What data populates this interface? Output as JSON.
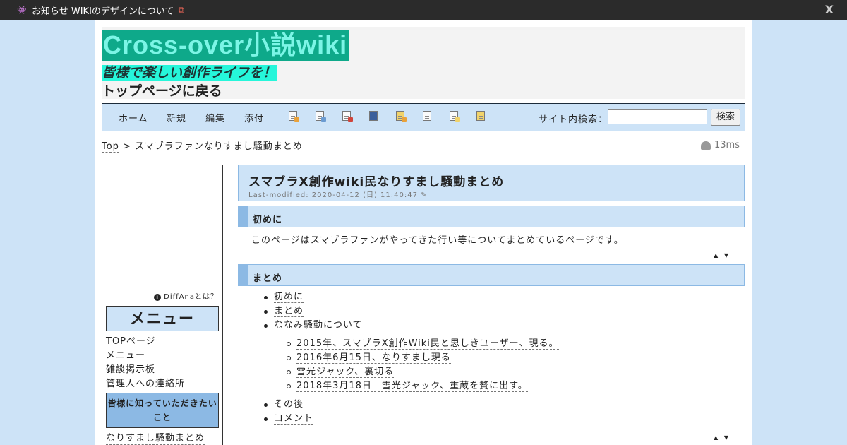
{
  "topbar": {
    "notice": "お知らせ WIKIのデザインについて",
    "close": "X"
  },
  "site": {
    "logo": "Cross-over小説wiki",
    "tagline": "皆様で楽しい創作ライフを！",
    "back_link": "トップページに戻る"
  },
  "nav": {
    "home": "ホーム",
    "new": "新規",
    "edit": "編集",
    "attach": "添付",
    "toolbar_icons": [
      "copy-page-icon",
      "rename-page-icon",
      "diff-page-icon",
      "backup-icon",
      "history-icon",
      "list-icon",
      "recent-icon",
      "help-icon"
    ]
  },
  "search": {
    "label": "サイト内検索：",
    "button": "検索",
    "value": ""
  },
  "breadcrumb": {
    "top": "Top",
    "sep": ">",
    "current": "スマブラファンなりすまし騒動まとめ"
  },
  "timer": "13ms",
  "sidebar": {
    "diffana": "DiffAnaとは？",
    "menu_title": "メニュー",
    "links": [
      "TOPページ",
      "メニュー",
      "雑談掲示板",
      "管理人への連絡所"
    ],
    "box": "皆様に知っていただきたいこと",
    "after_box": "なりすまし騒動まとめ"
  },
  "page": {
    "title": "スマブラX創作wiki民なりすまし騒動まとめ",
    "last_modified": "Last-modified: 2020-04-12 (日) 11:40:47",
    "sections": [
      {
        "heading": "初めに",
        "text": "このページはスマブラファンがやってきた行い等についてまとめているページです。"
      },
      {
        "heading": "まとめ"
      }
    ],
    "toc": [
      "初めに",
      "まとめ",
      "ななみ騒動について"
    ],
    "toc_sub": [
      "2015年、スマブラX創作Wiki民と思しきユーザー、現る。",
      "2016年6月15日、なりすまし現る",
      "雪光ジャック、裏切る",
      "2018年3月18日　雪光ジャック、重蔵を贅に出す。"
    ],
    "toc_after": [
      "その後",
      "コメント"
    ],
    "arrows": "▲ ▼"
  }
}
